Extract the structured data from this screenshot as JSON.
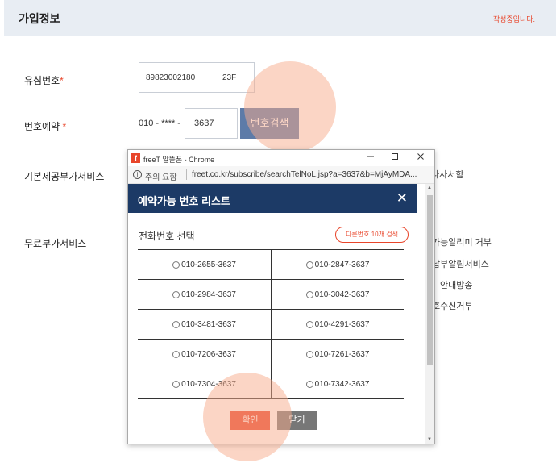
{
  "header": {
    "title": "가입정보",
    "status": "작성중입니다."
  },
  "form": {
    "usim_label": "유심번호",
    "usim_value": "89823002180",
    "usim_suffix": "23F",
    "number_reservation_label": "번호예약",
    "phone_prefix": "010 - **** -",
    "phone_last": "3637",
    "search_button": "번호검색",
    "basic_service_label": "기본제공부가서비스",
    "free_service_label": "무료부가서비스",
    "required_mark": "*"
  },
  "background_partial_text": {
    "basic_service_right": "나사서함",
    "free_service_lines": [
      "가능알리미 거부",
      "납부알림서비스",
      "안내방송",
      "호수신거부"
    ]
  },
  "chrome_window": {
    "title": "freeT 알뜰폰 - Chrome",
    "logo": "f",
    "secure_label": "주의 요함",
    "url": "freet.co.kr/subscribe/searchTelNoL.jsp?a=3637&b=MjAyMDA..."
  },
  "popup": {
    "title": "예약가능 번호 리스트",
    "select_label": "전화번호 선택",
    "other_numbers_button": "다른번호 10개 검색",
    "numbers": [
      [
        "010-2655-3637",
        "010-2847-3637"
      ],
      [
        "010-2984-3637",
        "010-3042-3637"
      ],
      [
        "010-3481-3637",
        "010-4291-3637"
      ],
      [
        "010-7206-3637",
        "010-7261-3637"
      ],
      [
        "010-7304-3637",
        "010-7342-3637"
      ]
    ],
    "confirm_button": "확인",
    "close_button": "닫기"
  },
  "colors": {
    "accent": "#e8452a",
    "header_bg": "#e8edf3",
    "popup_header": "#1c3a66",
    "search_button": "#5d7ba8",
    "close_button": "#777777",
    "highlight": "#f8ac8c"
  },
  "icons": {
    "logo": "freet-logo-icon",
    "info": "info-icon",
    "minimize": "minimize-icon",
    "maximize": "maximize-icon",
    "window_close": "close-icon",
    "popup_close": "close-icon",
    "radio": "radio-icon",
    "scroll_up": "arrow-up-icon",
    "scroll_down": "arrow-down-icon"
  }
}
